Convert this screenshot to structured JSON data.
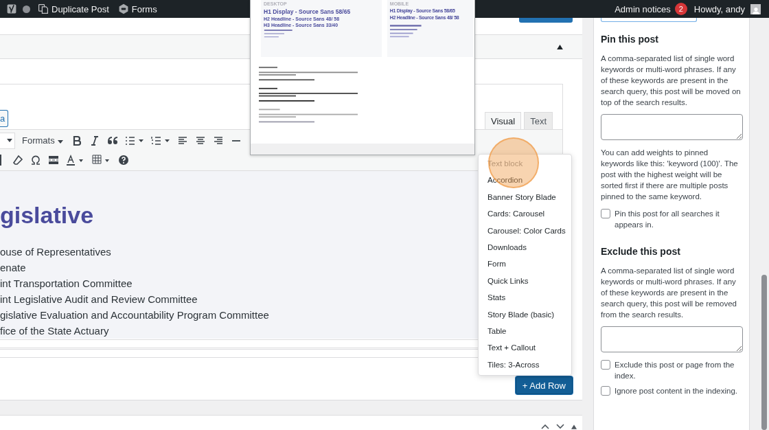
{
  "admin_bar": {
    "left": [
      {
        "kind": "yoast"
      },
      {
        "kind": "dot"
      },
      {
        "kind": "duplicate",
        "label": "Duplicate Post"
      },
      {
        "kind": "forms",
        "label": "Forms"
      }
    ],
    "notices": {
      "label": "Admin notices",
      "count": "2"
    },
    "greeting": "Howdy, andy"
  },
  "preview": {
    "desktop": {
      "label": "DESKTOP",
      "headings": [
        "H1 Display - Source Sans 58/65",
        "H2 Headline - Source Sans 48/ 58",
        "H3 Headline - Source Sans 33/40"
      ]
    },
    "mobile": {
      "label": "MOBILE",
      "headings": [
        "H1 Display - Source Sans 58/65",
        "H2 Headline - Source Sans 48/ 58"
      ]
    }
  },
  "editor": {
    "left_button": "a",
    "tabs": [
      {
        "label": "Visual",
        "selected": true
      },
      {
        "label": "Text",
        "selected": false
      }
    ],
    "formats": "Formats",
    "heading": "gislative",
    "lines": [
      "ouse of Representatives",
      "enate",
      "int Transportation Committee",
      "int Legislative Audit and Review Committee",
      "gislative Evaluation and Accountability Program Committee",
      "fice of the State Actuary"
    ]
  },
  "block_menu": {
    "items": [
      {
        "label": "Text block",
        "highlighted": true
      },
      {
        "label": "Accordion",
        "highlighted": false
      },
      {
        "label": "Banner Story Blade",
        "highlighted": false
      },
      {
        "label": "Cards: Carousel",
        "highlighted": false
      },
      {
        "label": "Carousel: Color Cards",
        "highlighted": false
      },
      {
        "label": "Downloads",
        "highlighted": false
      },
      {
        "label": "Form",
        "highlighted": false
      },
      {
        "label": "Quick Links",
        "highlighted": false
      },
      {
        "label": "Stats",
        "highlighted": false
      },
      {
        "label": "Story Blade (basic)",
        "highlighted": false
      },
      {
        "label": "Table",
        "highlighted": false
      },
      {
        "label": "Text + Callout",
        "highlighted": false
      },
      {
        "label": "Tiles: 3-Across",
        "highlighted": false
      }
    ]
  },
  "add_row": "+ Add Row",
  "sidebar": {
    "sections": [
      {
        "title": "Pin this post",
        "description": "A comma-separated list of single word keywords or multi-word phrases. If any of these keywords are present in the search query, this post will be moved on top of the search results.",
        "note": "You can add weights to pinned keywords like this: 'keyword (100)'. The post with the highest weight will be sorted first if there are multiple posts pinned to the same keyword.",
        "checkboxes": [
          {
            "label": "Pin this post for all searches it appears in.",
            "checked": false
          }
        ]
      },
      {
        "title": "Exclude this post",
        "description": "A comma-separated list of single word keywords or multi-word phrases. If any of these keywords are present in the search query, this post will be removed from the search results.",
        "checkboxes": [
          {
            "label": "Exclude this post or page from the index.",
            "checked": false
          },
          {
            "label": "Ignore post content in the indexing.",
            "checked": false
          }
        ]
      }
    ]
  }
}
